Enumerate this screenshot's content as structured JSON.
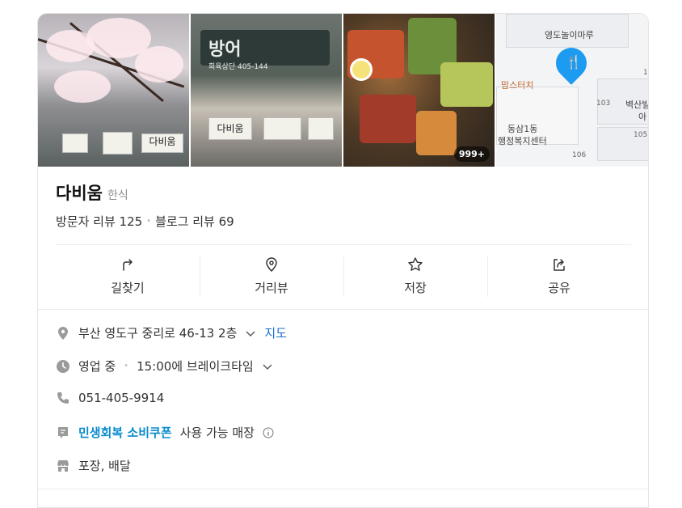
{
  "place": {
    "name": "다비움",
    "category": "한식",
    "visitor_review": "방문자 리뷰 125",
    "blog_review": "블로그 리뷰 69"
  },
  "photos": {
    "count_badge": "999+",
    "sign_text_1": "다비움",
    "sign_text_2": "다비움",
    "banner_text": "방어",
    "banner_sub": "회육상단 405-144"
  },
  "map": {
    "labels": [
      "영도놀이마루",
      "맘스터치",
      "동삼1동",
      "행정복지센터",
      "벽산빌",
      "아"
    ],
    "numbers": [
      "103",
      "105",
      "106",
      "1"
    ]
  },
  "actions": [
    {
      "label": "길찾기",
      "icon": "directions-icon"
    },
    {
      "label": "거리뷰",
      "icon": "street-view-icon"
    },
    {
      "label": "저장",
      "icon": "star-icon"
    },
    {
      "label": "공유",
      "icon": "share-icon"
    }
  ],
  "info": {
    "address": "부산 영도구 중리로 46-13 2층",
    "map_link": "지도",
    "status": "영업 중",
    "hours": "15:00에 브레이크타임",
    "phone": "051-405-9914",
    "coupon": "민생회복 소비쿠폰",
    "coupon_suffix": "사용 가능 매장",
    "services": "포장, 배달"
  },
  "colors": {
    "link": "#1b6fd1",
    "coupon": "#0a8ccd",
    "pin": "#1d9bf0"
  }
}
